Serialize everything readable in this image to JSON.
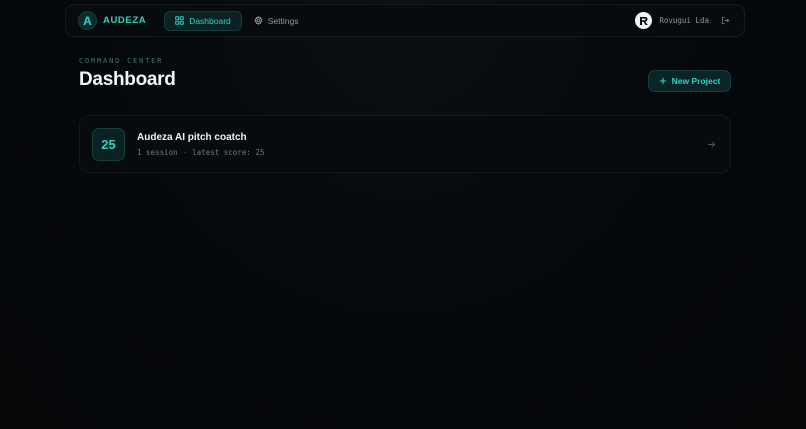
{
  "brand": {
    "logo_letter": "A",
    "name": "AUDEZA",
    "accent": "#2fd3c2"
  },
  "nav": {
    "items": [
      {
        "label": "Dashboard",
        "icon": "grid-icon",
        "active": true
      },
      {
        "label": "Settings",
        "icon": "gear-icon",
        "active": false
      }
    ]
  },
  "user": {
    "name": "Rovugui Lda",
    "logout_icon": "logout-icon"
  },
  "page": {
    "eyebrow": "COMMAND CENTER",
    "title": "Dashboard",
    "new_project_label": "New Project"
  },
  "projects": [
    {
      "score": "25",
      "title": "Audeza AI pitch coatch",
      "sessions": "1 session",
      "separator": "·",
      "latest_score": "latest score: 25"
    }
  ]
}
